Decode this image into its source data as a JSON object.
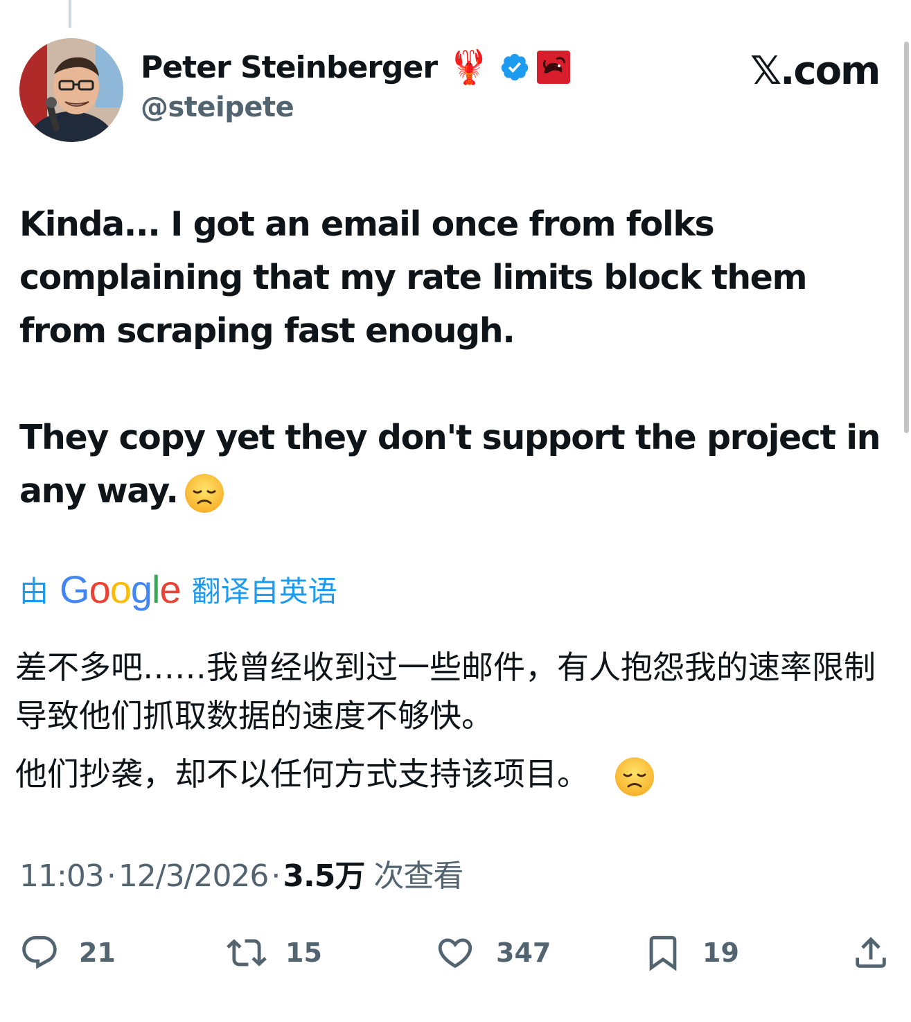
{
  "author": {
    "name": "Peter Steinberger",
    "name_emoji": "🦞",
    "handle": "@steipete"
  },
  "brand": "𝕏.com",
  "tweet": {
    "paragraphs": [
      "Kinda... I got an email once from folks complaining that my rate limits block them from scraping fast enough.",
      "They copy yet they don't support the project in any way."
    ],
    "trailing_emoji": "disappointed-face"
  },
  "translation": {
    "prefix": "由",
    "provider": "Google",
    "suffix": "翻译自英语",
    "paragraphs": [
      "差不多吧……我曾经收到过一些邮件，有人抱怨我的速率限制导致他们抓取数据的速度不够快。",
      "他们抄袭，却不以任何方式支持该项目。"
    ]
  },
  "meta": {
    "time": "11:03",
    "date": "12/3/2026",
    "views_count": "3.5万",
    "views_label": "次查看",
    "separator": "·"
  },
  "actions": {
    "replies": "21",
    "reposts": "15",
    "likes": "347",
    "bookmarks": "19"
  },
  "colors": {
    "text": "#0f1419",
    "secondary": "#536471",
    "link": "#1d9bf0",
    "verified": "#1d9bf0",
    "affiliate_badge": "#d81e2c"
  },
  "icons": {
    "verified": "verified-badge-icon",
    "affiliate": "lobster-affiliate-badge-icon",
    "reply": "reply-icon",
    "repost": "repost-icon",
    "like": "heart-icon",
    "bookmark": "bookmark-icon",
    "share": "share-icon"
  }
}
